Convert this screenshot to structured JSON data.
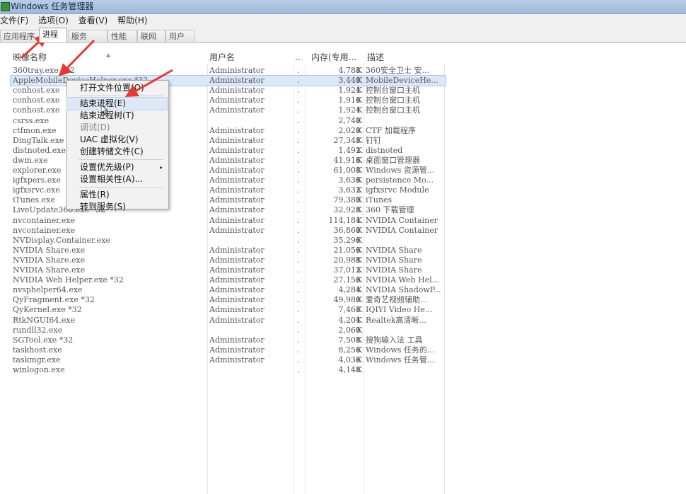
{
  "window": {
    "title": "Windows 任务管理器"
  },
  "menu": {
    "items": [
      "文件(F)",
      "选项(O)",
      "查看(V)",
      "帮助(H)"
    ]
  },
  "tabs": [
    "应用程序",
    "进程",
    "服务",
    "性能",
    "联网",
    "用户"
  ],
  "active_tab": "进程",
  "columns": {
    "name": "映像名称",
    "user": "用户名",
    "dot": "..",
    "memory": "内存(专用...",
    "description": "描述"
  },
  "rows": [
    {
      "name": "360tray.exe *32",
      "user": "Administrator",
      "dot": ".",
      "mem": "4,788",
      "k": "K",
      "desc": "360安全卫士 安..."
    },
    {
      "name": "AppleMobileDeviceHelper.exe *32",
      "user": "Administrator",
      "dot": ".",
      "mem": "3,440",
      "k": "K",
      "desc": "MobileDeviceHe..."
    },
    {
      "name": "conhost.exe",
      "user": "Administrator",
      "dot": ".",
      "mem": "1,924",
      "k": "K",
      "desc": "控制台窗口主机"
    },
    {
      "name": "conhost.exe",
      "user": "Administrator",
      "dot": ".",
      "mem": "1,916",
      "k": "K",
      "desc": "控制台窗口主机"
    },
    {
      "name": "conhost.exe",
      "user": "Administrator",
      "dot": ".",
      "mem": "1,924",
      "k": "K",
      "desc": "控制台窗口主机"
    },
    {
      "name": "csrss.exe",
      "user": "",
      "dot": ".",
      "mem": "2,740",
      "k": "K",
      "desc": ""
    },
    {
      "name": "ctfmon.exe",
      "user": "Administrator",
      "dot": ".",
      "mem": "2,020",
      "k": "K",
      "desc": "CTF 加载程序"
    },
    {
      "name": "DingTalk.exe",
      "user": "Administrator",
      "dot": ".",
      "mem": "27,348",
      "k": "K",
      "desc": "钉钉"
    },
    {
      "name": "distnoted.exe",
      "user": "Administrator",
      "dot": ".",
      "mem": "1,492",
      "k": "K",
      "desc": "distnoted"
    },
    {
      "name": "dwm.exe",
      "user": "Administrator",
      "dot": ".",
      "mem": "41,916",
      "k": "K",
      "desc": "桌面窗口管理器"
    },
    {
      "name": "explorer.exe",
      "user": "Administrator",
      "dot": ".",
      "mem": "61,008",
      "k": "K",
      "desc": "Windows 资源管..."
    },
    {
      "name": "igfxpers.exe",
      "user": "Administrator",
      "dot": ".",
      "mem": "3,636",
      "k": "K",
      "desc": "persistence Mo..."
    },
    {
      "name": "igfxsrvc.exe",
      "user": "Administrator",
      "dot": ".",
      "mem": "3,632",
      "k": "K",
      "desc": "igfxsrvc Module"
    },
    {
      "name": "iTunes.exe",
      "user": "Administrator",
      "dot": ".",
      "mem": "79,380",
      "k": "K",
      "desc": "iTunes"
    },
    {
      "name": "LiveUpdate360.exe *32",
      "user": "Administrator",
      "dot": ".",
      "mem": "32,928",
      "k": "K",
      "desc": "360 下载管理"
    },
    {
      "name": "nvcontainer.exe",
      "user": "Administrator",
      "dot": ".",
      "mem": "114,184",
      "k": "K",
      "desc": "NVIDIA Container"
    },
    {
      "name": "nvcontainer.exe",
      "user": "Administrator",
      "dot": ".",
      "mem": "36,860",
      "k": "K",
      "desc": "NVIDIA Container"
    },
    {
      "name": "NVDisplay.Container.exe",
      "user": "",
      "dot": ".",
      "mem": "35,296",
      "k": "K",
      "desc": ""
    },
    {
      "name": "NVIDIA Share.exe",
      "user": "Administrator",
      "dot": ".",
      "mem": "21,056",
      "k": "K",
      "desc": "NVIDIA Share"
    },
    {
      "name": "NVIDIA Share.exe",
      "user": "Administrator",
      "dot": ".",
      "mem": "20,988",
      "k": "K",
      "desc": "NVIDIA Share"
    },
    {
      "name": "NVIDIA Share.exe",
      "user": "Administrator",
      "dot": ".",
      "mem": "37,012",
      "k": "K",
      "desc": "NVIDIA Share"
    },
    {
      "name": "NVIDIA Web Helper.exe *32",
      "user": "Administrator",
      "dot": ".",
      "mem": "27,156",
      "k": "K",
      "desc": "NVIDIA Web Hel..."
    },
    {
      "name": "nvsphelper64.exe",
      "user": "Administrator",
      "dot": ".",
      "mem": "4,284",
      "k": "K",
      "desc": "NVIDIA ShadowP..."
    },
    {
      "name": "QyFragment.exe *32",
      "user": "Administrator",
      "dot": ".",
      "mem": "49,980",
      "k": "K",
      "desc": "爱奇艺视频辅助..."
    },
    {
      "name": "QyKernel.exe *32",
      "user": "Administrator",
      "dot": ".",
      "mem": "7,468",
      "k": "K",
      "desc": "IQIYI Video He..."
    },
    {
      "name": "RtkNGUI64.exe",
      "user": "Administrator",
      "dot": ".",
      "mem": "4,204",
      "k": "K",
      "desc": "Realtek高清晰..."
    },
    {
      "name": "rundll32.exe",
      "user": "",
      "dot": ".",
      "mem": "2,060",
      "k": "K",
      "desc": ""
    },
    {
      "name": "SGTool.exe *32",
      "user": "Administrator",
      "dot": ".",
      "mem": "7,508",
      "k": "K",
      "desc": "搜狗输入法 工具"
    },
    {
      "name": "taskhost.exe",
      "user": "Administrator",
      "dot": ".",
      "mem": "8,256",
      "k": "K",
      "desc": "Windows 任务的..."
    },
    {
      "name": "taskmgr.exe",
      "user": "Administrator",
      "dot": ".",
      "mem": "4,036",
      "k": "K",
      "desc": "Windows 任务管..."
    },
    {
      "name": "winlogon.exe",
      "user": "",
      "dot": ".",
      "mem": "4,148",
      "k": "K",
      "desc": ""
    }
  ],
  "selected_row": 1,
  "context_menu": {
    "items": [
      {
        "label": "打开文件位置(O)",
        "disabled": false
      },
      {
        "separator": true
      },
      {
        "label": "结束进程(E)",
        "disabled": false,
        "highlighted": true
      },
      {
        "label": "结束进程树(T)",
        "disabled": false
      },
      {
        "label": "调试(D)",
        "disabled": true
      },
      {
        "label": "UAC 虚拟化(V)",
        "disabled": false
      },
      {
        "label": "创建转储文件(C)",
        "disabled": false
      },
      {
        "separator": true
      },
      {
        "label": "设置优先级(P)",
        "disabled": false,
        "submenu": true
      },
      {
        "label": "设置相关性(A)...",
        "disabled": false
      },
      {
        "separator": true
      },
      {
        "label": "属性(R)",
        "disabled": false
      },
      {
        "label": "转到服务(S)",
        "disabled": false
      }
    ]
  },
  "colors": {
    "annotation_arrow": "#e53935",
    "selection": "#dbe8f7",
    "highlight": "#dfe9f6"
  },
  "icons": {
    "app": "task-manager-icon",
    "sort": "sort-up-icon",
    "submenu": "chevron-right-icon",
    "cursor": "mouse-cursor-icon"
  }
}
